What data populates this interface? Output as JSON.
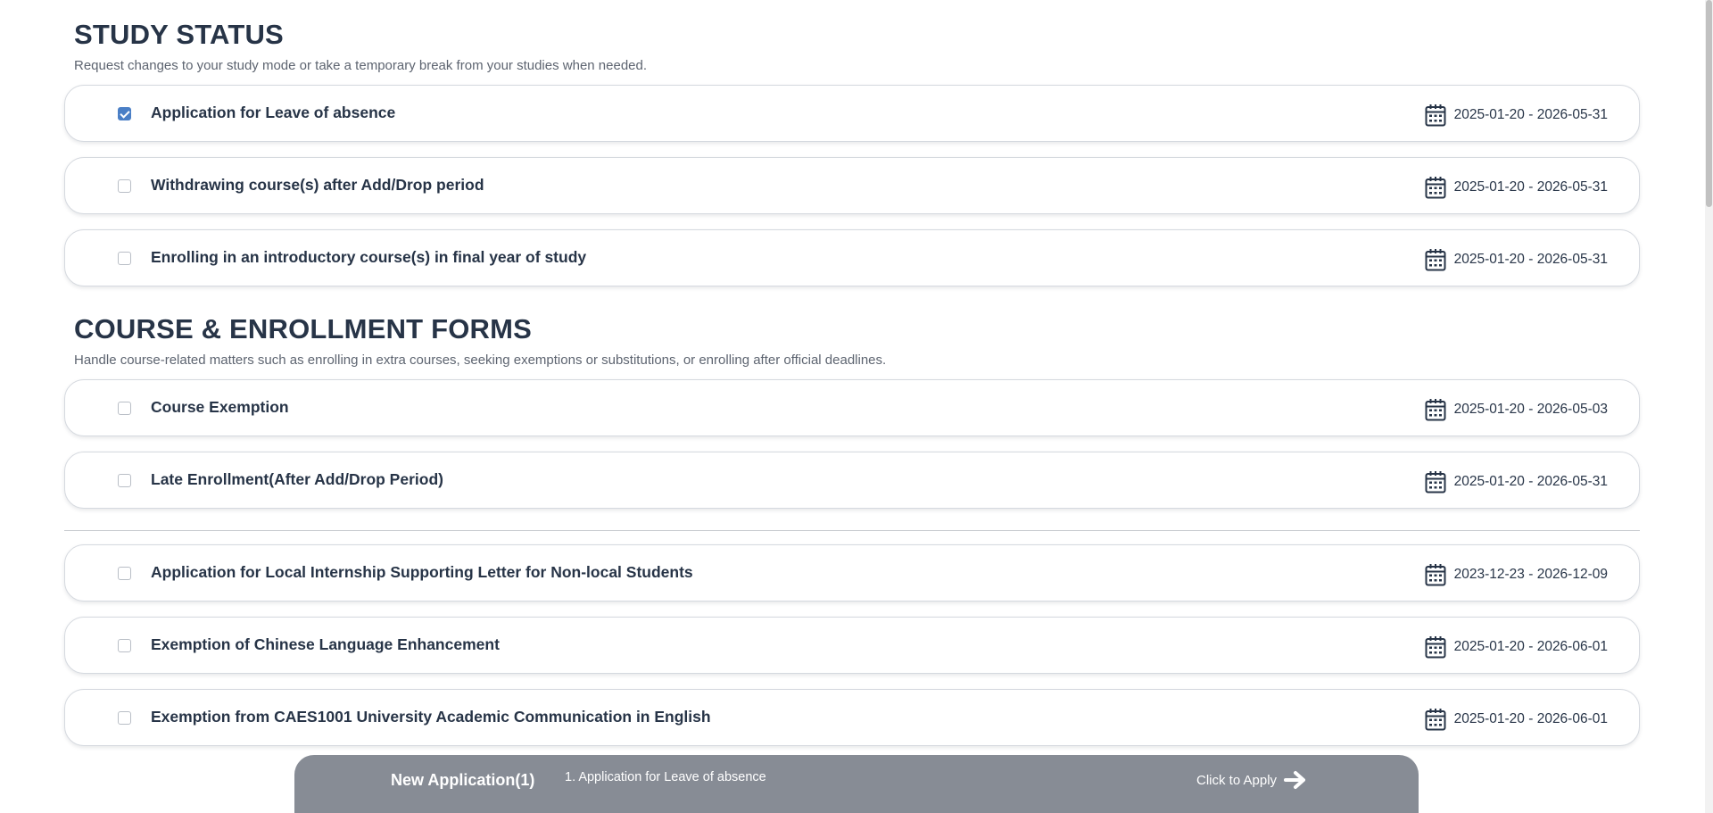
{
  "sections": [
    {
      "title": "STUDY STATUS",
      "description": "Request changes to your study mode or take a temporary break from your studies when needed."
    },
    {
      "title": "COURSE & ENROLLMENT FORMS",
      "description": "Handle course-related matters such as enrolling in extra courses, seeking exemptions or substitutions, or enrolling after official deadlines."
    }
  ],
  "forms": [
    {
      "label": "Application for Leave of absence",
      "date_range": "2025-01-20 - 2026-05-31",
      "checked": true
    },
    {
      "label": "Withdrawing course(s) after Add/Drop period",
      "date_range": "2025-01-20 - 2026-05-31",
      "checked": false
    },
    {
      "label": "Enrolling in an introductory course(s) in final year of study",
      "date_range": "2025-01-20 - 2026-05-31",
      "checked": false
    },
    {
      "label": "Course Exemption",
      "date_range": "2025-01-20 - 2026-05-03",
      "checked": false
    },
    {
      "label": "Late Enrollment(After Add/Drop Period)",
      "date_range": "2025-01-20 - 2026-05-31",
      "checked": false
    },
    {
      "label": "Application for Local Internship Supporting Letter for Non-local Students",
      "date_range": "2023-12-23 - 2026-12-09",
      "checked": false
    },
    {
      "label": "Exemption of Chinese Language Enhancement",
      "date_range": "2025-01-20 - 2026-06-01",
      "checked": false
    },
    {
      "label": "Exemption from CAES1001 University Academic Communication in English",
      "date_range": "2025-01-20 - 2026-06-01",
      "checked": false
    }
  ],
  "bottom_bar": {
    "title": "New Application(1)",
    "items": [
      "1. Application for Leave of absence"
    ],
    "apply_label": "Click to Apply"
  },
  "icons": {
    "calendar": "calendar-icon",
    "checkbox": "checkbox-icon",
    "arrow": "arrow-right-icon"
  },
  "colors": {
    "heading": "#273447",
    "accent_checkbox": "#4a7fc6",
    "bottom_bar": "#878c95"
  }
}
